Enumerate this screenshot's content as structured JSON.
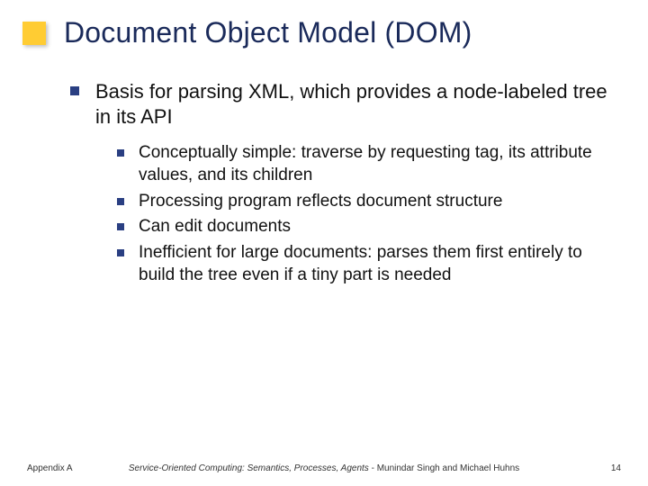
{
  "slide": {
    "title": "Document Object Model (DOM)",
    "level1": [
      {
        "text": "Basis for parsing XML, which provides a node-labeled tree in its API",
        "children": [
          "Conceptually simple: traverse by requesting tag, its attribute values, and its children",
          "Processing program reflects document structure",
          "Can edit documents",
          "Inefficient for large documents: parses them first entirely to build the tree even if a tiny part is needed"
        ]
      }
    ],
    "footer": {
      "left": "Appendix A",
      "center_italic": "Service-Oriented Computing: Semantics, Processes, Agents",
      "center_plain": " - Munindar Singh and Michael Huhns",
      "right": "14"
    }
  }
}
